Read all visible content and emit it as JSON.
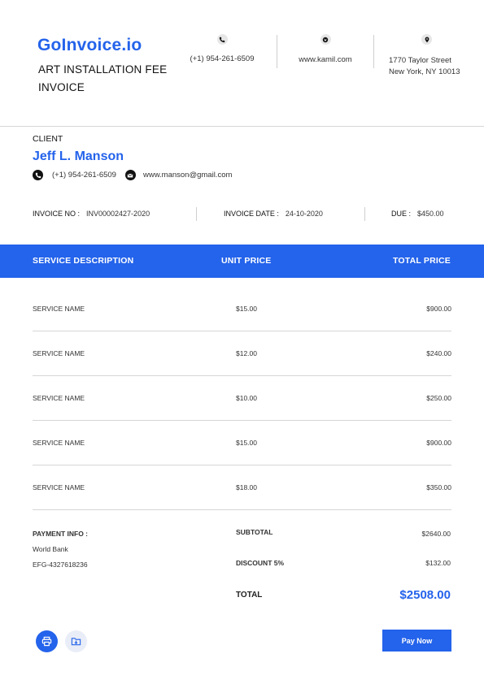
{
  "header": {
    "brand": "GoInvoice.io",
    "title": "ART INSTALLATION FEE INVOICE",
    "contacts": [
      {
        "icon": "phone-icon",
        "line1": "(+1) 954-261-6509",
        "line2": ""
      },
      {
        "icon": "globe-icon",
        "line1": "www.kamil.com",
        "line2": ""
      },
      {
        "icon": "location-pin-icon",
        "line1": "1770 Taylor Street",
        "line2": "New York, NY 10013"
      }
    ]
  },
  "client": {
    "label": "CLIENT",
    "name": "Jeff L. Manson",
    "phone": "(+1) 954-261-6509",
    "email": "www.manson@gmail.com"
  },
  "meta": {
    "invoice_no_label": "INVOICE NO :",
    "invoice_no": "INV00002427-2020",
    "invoice_date_label": "INVOICE DATE :",
    "invoice_date": "24-10-2020",
    "due_label": "DUE :",
    "due": "$450.00"
  },
  "table": {
    "headers": [
      "SERVICE DESCRIPTION",
      "UNIT PRICE",
      "TOTAL PRICE"
    ],
    "rows": [
      {
        "name": "SERVICE NAME",
        "unit": "$15.00",
        "total": "$900.00"
      },
      {
        "name": "SERVICE NAME",
        "unit": "$12.00",
        "total": "$240.00"
      },
      {
        "name": "SERVICE NAME",
        "unit": "$10.00",
        "total": "$250.00"
      },
      {
        "name": "SERVICE NAME",
        "unit": "$15.00",
        "total": "$900.00"
      },
      {
        "name": "SERVICE NAME",
        "unit": "$18.00",
        "total": "$350.00"
      }
    ]
  },
  "payment": {
    "label": "PAYMENT INFO :",
    "bank": "World Bank",
    "account": "EFG-4327618236"
  },
  "summary": {
    "subtotal_label": "SUBTOTAL",
    "subtotal": "$2640.00",
    "discount_label": "DISCOUNT 5%",
    "discount": "$132.00",
    "total_label": "TOTAL",
    "total": "$2508.00"
  },
  "actions": {
    "print_icon": "printer-icon",
    "download_icon": "folder-download-icon",
    "pay_label": "Pay Now"
  },
  "colors": {
    "accent": "#2463eb",
    "text": "#333333",
    "divider": "#d6d6d6"
  }
}
